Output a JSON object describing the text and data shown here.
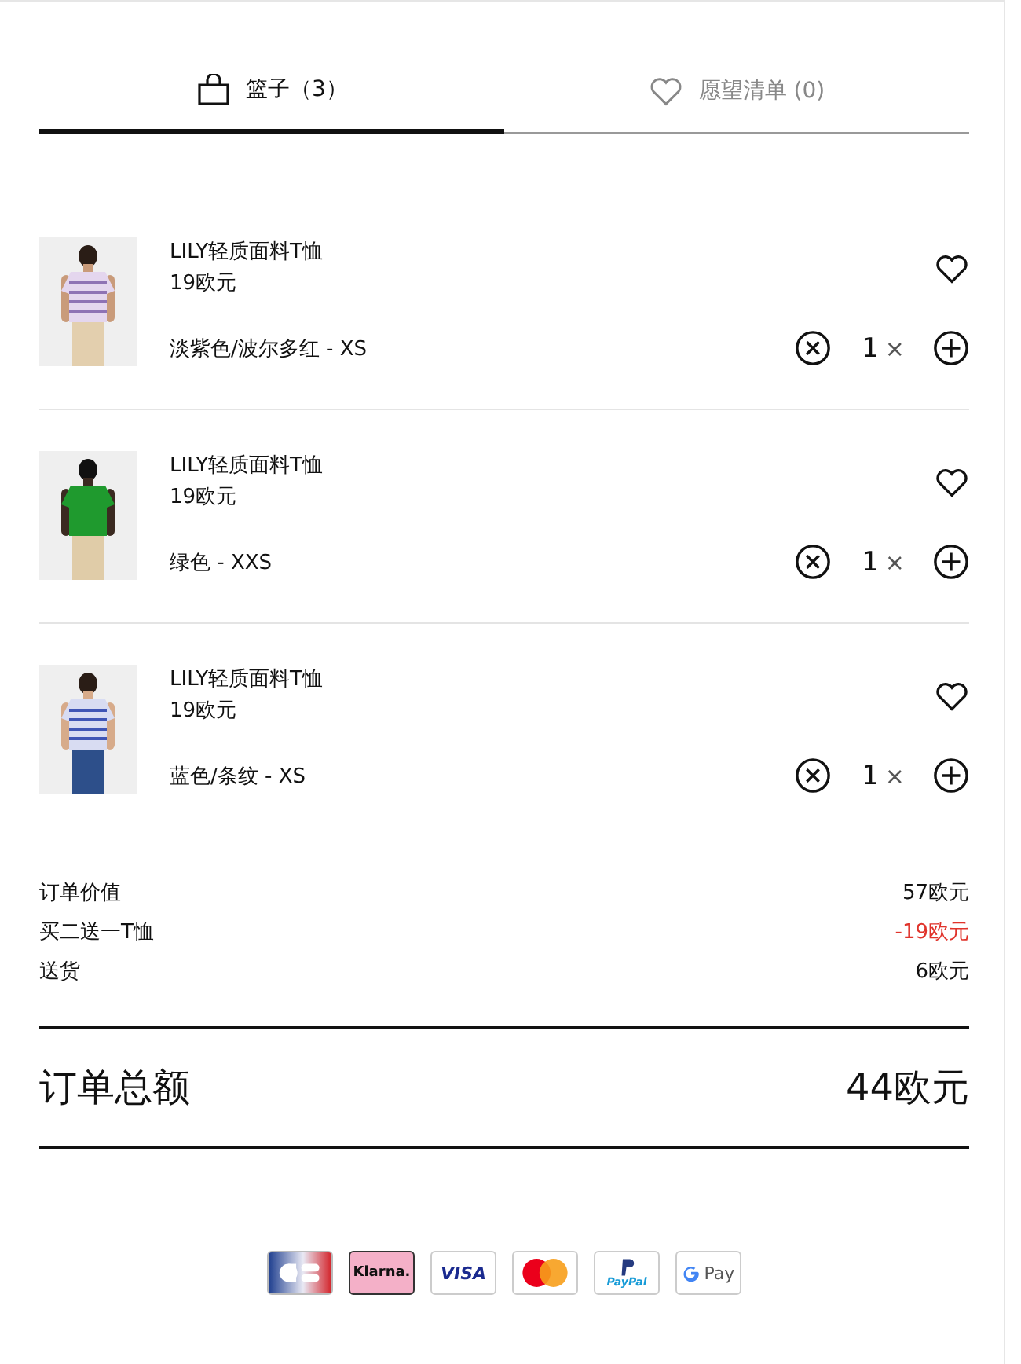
{
  "tabs": [
    {
      "kind": "bag",
      "label": "篮子（3）",
      "selected": true
    },
    {
      "kind": "heart",
      "label": "愿望清单 (0)",
      "selected": false
    }
  ],
  "items": [
    {
      "name": "LILY轻质面料T恤",
      "price": "19欧元",
      "variant": "淡紫色/波尔多红 - XS",
      "quantity": "1",
      "times": "×"
    },
    {
      "name": "LILY轻质面料T恤",
      "price": "19欧元",
      "variant": "绿色 - XXS",
      "quantity": "1",
      "times": "×"
    },
    {
      "name": "LILY轻质面料T恤",
      "price": "19欧元",
      "variant": "蓝色/条纹 - XS",
      "quantity": "1",
      "times": "×"
    }
  ],
  "summary": [
    {
      "label": "订单价值",
      "value": "57欧元",
      "kind": "normal"
    },
    {
      "label": "买二送一T恤",
      "value": "-19欧元",
      "kind": "discount"
    },
    {
      "label": "送货",
      "value": "6欧元",
      "kind": "normal"
    }
  ],
  "total": {
    "label": "订单总额",
    "value": "44欧元"
  },
  "payments": [
    {
      "kind": "cb"
    },
    {
      "kind": "klarna",
      "label": "Klarna."
    },
    {
      "kind": "visa",
      "label": "VISA"
    },
    {
      "kind": "mastercard"
    },
    {
      "kind": "paypal",
      "label": "PayPal"
    },
    {
      "kind": "gpay",
      "label": "Pay"
    }
  ]
}
